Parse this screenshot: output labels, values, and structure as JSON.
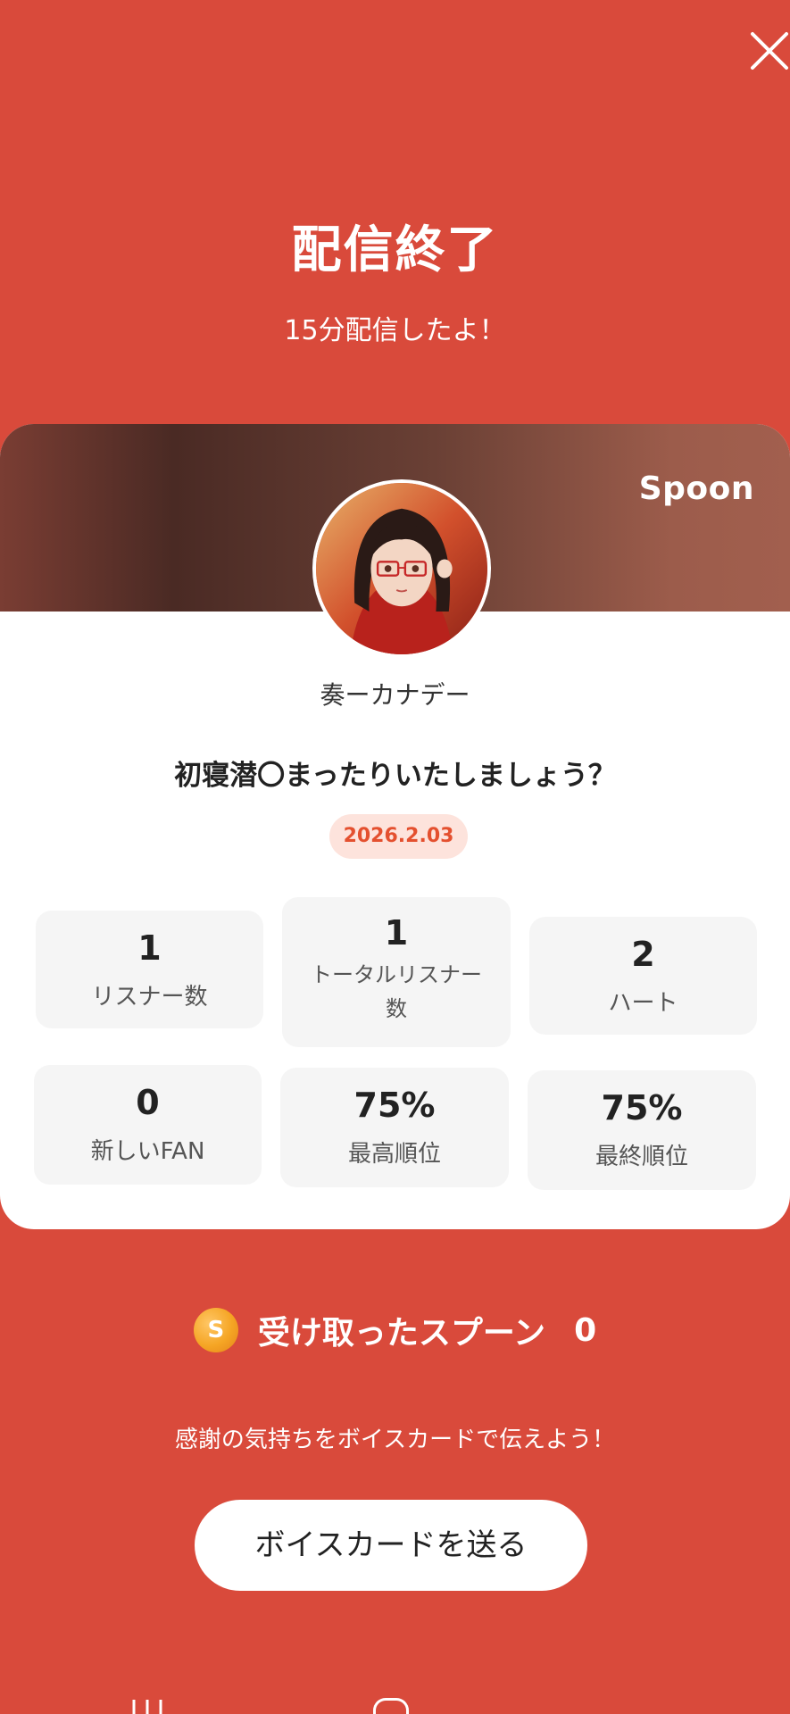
{
  "header": {
    "title": "配信終了",
    "subtitle": "15分配信したよ！"
  },
  "card": {
    "brand": "Spoon",
    "username": "奏ーカナデー",
    "stream_title": "初寝潜〇まったりいたしましょう？",
    "date": "2026.2.03",
    "stats": [
      {
        "value": "1",
        "label": "リスナー数"
      },
      {
        "value": "1",
        "label": "トータルリスナー数"
      },
      {
        "value": "2",
        "label": "ハート"
      },
      {
        "value": "0",
        "label": "新しいFAN"
      },
      {
        "value": "75%",
        "label": "最高順位"
      },
      {
        "value": "75%",
        "label": "最終順位"
      }
    ]
  },
  "spoons": {
    "coin_letter": "S",
    "label": "受け取ったスプーン",
    "count": "0"
  },
  "footer": {
    "thanks_message": "感謝の気持ちをボイスカードで伝えよう！",
    "voice_card_button": "ボイスカードを送る"
  },
  "colors": {
    "background": "#d94a3b",
    "date_text": "#e4502f",
    "date_bg": "#fde3dc",
    "coin": "#f5a524"
  }
}
